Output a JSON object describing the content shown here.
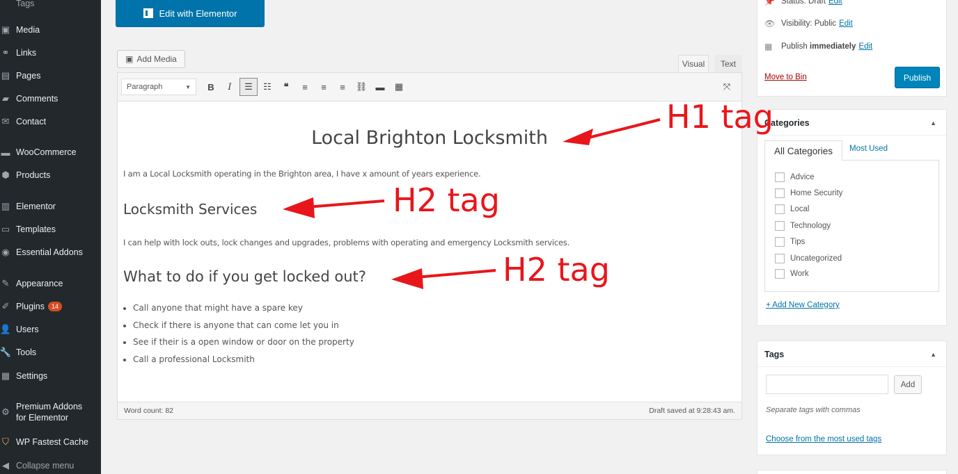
{
  "sidebar": {
    "items": [
      {
        "label": "Tags",
        "icon": "tag-icon"
      },
      {
        "label": "Media",
        "icon": "media-icon"
      },
      {
        "label": "Links",
        "icon": "links-icon"
      },
      {
        "label": "Pages",
        "icon": "pages-icon"
      },
      {
        "label": "Comments",
        "icon": "comments-icon"
      },
      {
        "label": "Contact",
        "icon": "contact-icon"
      },
      {
        "label": "WooCommerce",
        "icon": "woocommerce-icon"
      },
      {
        "label": "Products",
        "icon": "products-icon"
      },
      {
        "label": "Elementor",
        "icon": "elementor-icon"
      },
      {
        "label": "Templates",
        "icon": "templates-icon"
      },
      {
        "label": "Essential Addons",
        "icon": "essential-addons-icon"
      },
      {
        "label": "Appearance",
        "icon": "appearance-icon"
      },
      {
        "label": "Plugins",
        "icon": "plugins-icon",
        "badge": "14"
      },
      {
        "label": "Users",
        "icon": "users-icon"
      },
      {
        "label": "Tools",
        "icon": "tools-icon"
      },
      {
        "label": "Settings",
        "icon": "settings-icon"
      },
      {
        "label": "Premium Addons",
        "label2": "for Elementor",
        "icon": "premium-addons-icon"
      },
      {
        "label": "WP Fastest Cache",
        "icon": "wp-fastest-cache-icon"
      },
      {
        "label": "Collapse menu",
        "icon": "collapse-icon"
      }
    ]
  },
  "elementor_button": "Edit with Elementor",
  "editor": {
    "add_media": "Add Media",
    "tabs": {
      "visual": "Visual",
      "text": "Text"
    },
    "format_select": "Paragraph",
    "content": {
      "h1": "Local Brighton Locksmith",
      "p1": "I am a Local Locksmith operating in the Brighton area, I have x amount of years experience.",
      "h2_1": "Locksmith Services",
      "p2": "I can help with lock outs, lock changes and upgrades, problems with operating and emergency Locksmith services.",
      "h2_2": "What to do if you get locked out?",
      "list": [
        "Call anyone that might have a spare key",
        "Check if there is anyone that can come let you in",
        "See if their is a open window or door on the property",
        "Call a professional Locksmith"
      ]
    },
    "word_count": "Word count: 82",
    "draft_saved": "Draft saved at 9:28:43 am."
  },
  "annotations": {
    "h1": "H1 tag",
    "h2_a": "H2 tag",
    "h2_b": "H2 tag",
    "color": "#e8161b"
  },
  "publish": {
    "status_label": "Status:",
    "status_value": "Draft",
    "visibility_label": "Visibility:",
    "visibility_value": "Public",
    "publish_label": "Publish",
    "publish_value": "immediately",
    "edit": "Edit",
    "move_to_bin": "Move to Bin",
    "publish_button": "Publish"
  },
  "categories": {
    "title": "Categories",
    "tab_all": "All Categories",
    "tab_used": "Most Used",
    "items": [
      "Advice",
      "Home Security",
      "Local",
      "Technology",
      "Tips",
      "Uncategorized",
      "Work"
    ],
    "add_new": "+ Add New Category"
  },
  "tags": {
    "title": "Tags",
    "add_button": "Add",
    "help": "Separate tags with commas",
    "choose": "Choose from the most used tags"
  }
}
